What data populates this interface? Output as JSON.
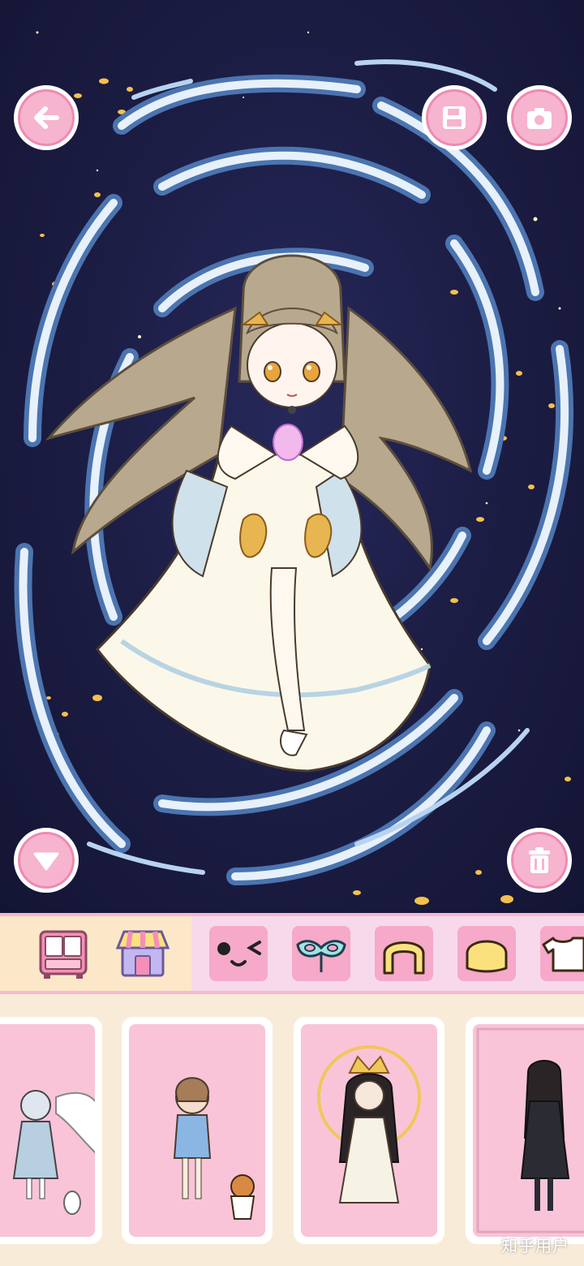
{
  "top_controls": {
    "back": {
      "icon": "arrow-left-icon"
    },
    "save": {
      "icon": "floppy-disk-icon"
    },
    "screenshot": {
      "icon": "camera-icon"
    },
    "collapse": {
      "icon": "triangle-down-icon"
    },
    "delete": {
      "icon": "trash-icon"
    }
  },
  "toolbar": {
    "left_tools": [
      {
        "name": "wardrobe-button",
        "icon": "wardrobe-icon"
      },
      {
        "name": "shop-button",
        "icon": "shop-icon"
      }
    ],
    "categories": [
      {
        "name": "category-face",
        "icon": "face-wink-icon"
      },
      {
        "name": "category-mask",
        "icon": "mask-icon"
      },
      {
        "name": "category-front-hair",
        "icon": "front-hair-icon"
      },
      {
        "name": "category-back-hair",
        "icon": "back-hair-icon"
      },
      {
        "name": "category-top",
        "icon": "shirt-icon"
      }
    ]
  },
  "outfit_cards": [
    {
      "name": "outfit-winged-girl"
    },
    {
      "name": "outfit-girl-with-cat"
    },
    {
      "name": "outfit-gold-crown-girl"
    },
    {
      "name": "outfit-dark-dress-girl"
    }
  ],
  "colors": {
    "accent_pink": "#f6b4cf",
    "toolbar_pink": "#fbd8e6",
    "shelf_cream": "#f8ecd9",
    "night_sky": "#1b1c42"
  },
  "watermark": "知乎用户"
}
